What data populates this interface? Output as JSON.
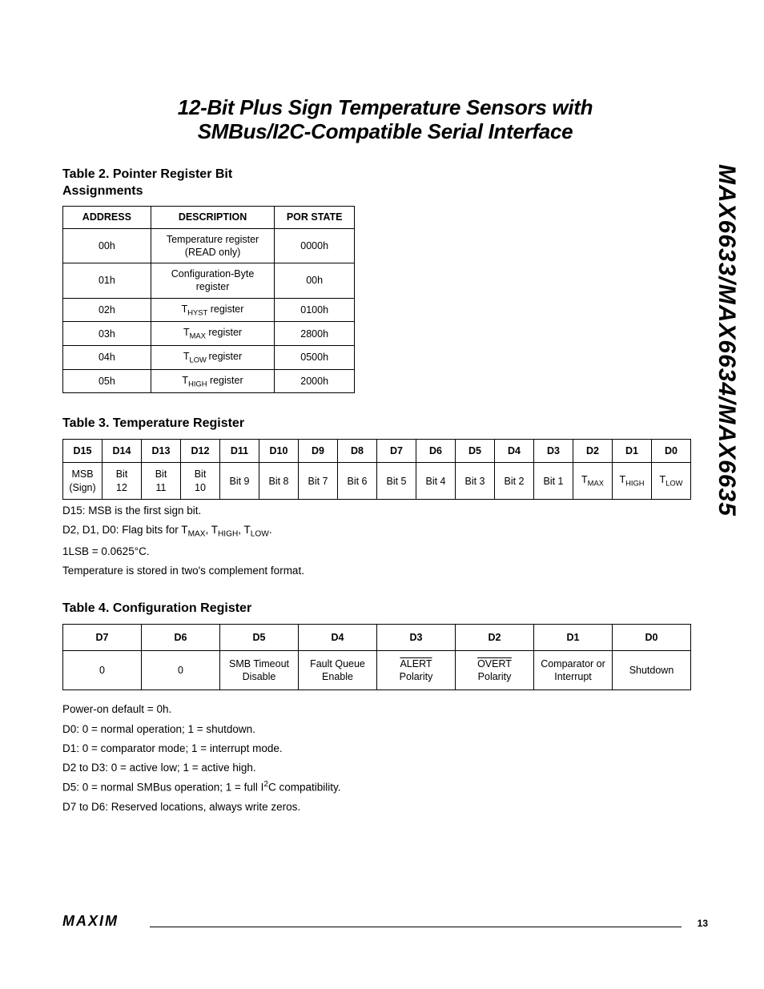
{
  "sidebar": "MAX6633/MAX6634/MAX6635",
  "title_line1": "12-Bit Plus Sign Temperature Sensors with",
  "title_line2": "SMBus/I2C-Compatible Serial Interface",
  "table2": {
    "title": "Table 2. Pointer Register Bit Assignments",
    "headers": [
      "ADDRESS",
      "DESCRIPTION",
      "POR STATE"
    ],
    "rows": [
      {
        "addr": "00h",
        "desc": "Temperature register (READ only)",
        "por": "0000h"
      },
      {
        "addr": "01h",
        "desc": "Configuration-Byte register",
        "por": "00h"
      },
      {
        "addr": "02h",
        "desc_html": "T<sub>HYST</sub> register",
        "por": "0100h"
      },
      {
        "addr": "03h",
        "desc_html": "T<sub>MAX</sub> register",
        "por": "2800h"
      },
      {
        "addr": "04h",
        "desc_html": "T<sub>LOW</sub> register",
        "por": "0500h"
      },
      {
        "addr": "05h",
        "desc_html": "T<sub>HIGH</sub> register",
        "por": "2000h"
      }
    ]
  },
  "table3": {
    "title": "Table 3. Temperature Register",
    "headers": [
      "D15",
      "D14",
      "D13",
      "D12",
      "D11",
      "D10",
      "D9",
      "D8",
      "D7",
      "D6",
      "D5",
      "D4",
      "D3",
      "D2",
      "D1",
      "D0"
    ],
    "row": [
      "MSB (Sign)",
      "Bit 12",
      "Bit 11",
      "Bit 10",
      "Bit 9",
      "Bit 8",
      "Bit 7",
      "Bit 6",
      "Bit 5",
      "Bit 4",
      "Bit 3",
      "Bit 2",
      "Bit 1",
      "T_MAX",
      "T_HIGH",
      "T_LOW"
    ],
    "notes": [
      "D15: MSB is the first sign bit.",
      "D2, D1, D0: Flag bits for T_MAX, T_HIGH, T_LOW.",
      "1LSB = 0.0625°C.",
      "Temperature is stored in two's complement format."
    ]
  },
  "table4": {
    "title": "Table 4. Configuration Register",
    "headers": [
      "D7",
      "D6",
      "D5",
      "D4",
      "D3",
      "D2",
      "D1",
      "D0"
    ],
    "row": [
      "0",
      "0",
      "SMB Timeout Disable",
      "Fault Queue Enable",
      "ALERT Polarity",
      "OVERT Polarity",
      "Comparator or Interrupt",
      "Shutdown"
    ],
    "notes": [
      "Power-on default = 0h.",
      "D0: 0 = normal operation; 1 = shutdown.",
      "D1: 0 = comparator mode; 1 = interrupt mode.",
      "D2 to D3: 0 = active low; 1 = active high.",
      "D5: 0 = normal SMBus operation; 1 = full I2C compatibility.",
      "D7 to D6: Reserved locations, always write zeros."
    ]
  },
  "footer": {
    "logo": "MAXIM",
    "page": "13"
  }
}
